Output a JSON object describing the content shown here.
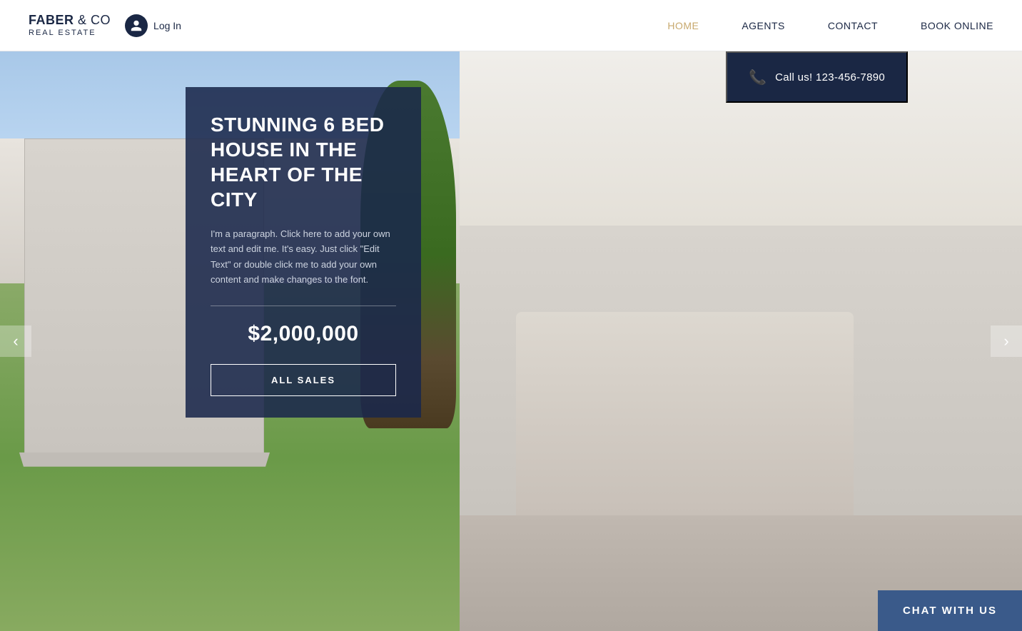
{
  "brand": {
    "name_bold": "FABER",
    "name_and": "& CO",
    "name_sub": "REAL ESTATE"
  },
  "header": {
    "login_label": "Log In",
    "nav_items": [
      {
        "label": "HOME",
        "active": true
      },
      {
        "label": "AGENTS",
        "active": false
      },
      {
        "label": "CONTACT",
        "active": false
      },
      {
        "label": "BOOK ONLINE",
        "active": false
      }
    ],
    "call_label": "Call us! 123-456-7890"
  },
  "hero": {
    "property_title": "STUNNING 6 BED HOUSE IN THE HEART OF THE CITY",
    "property_desc": "I'm a paragraph. Click here to add your own text and edit me. It's easy. Just click \"Edit Text\" or double click me to add your own content and make changes to the font.",
    "property_price": "$2,000,000",
    "all_sales_label": "ALL SALES",
    "carousel_prev": "‹",
    "carousel_next": "›"
  },
  "chat": {
    "label": "CHAT WITH US"
  }
}
